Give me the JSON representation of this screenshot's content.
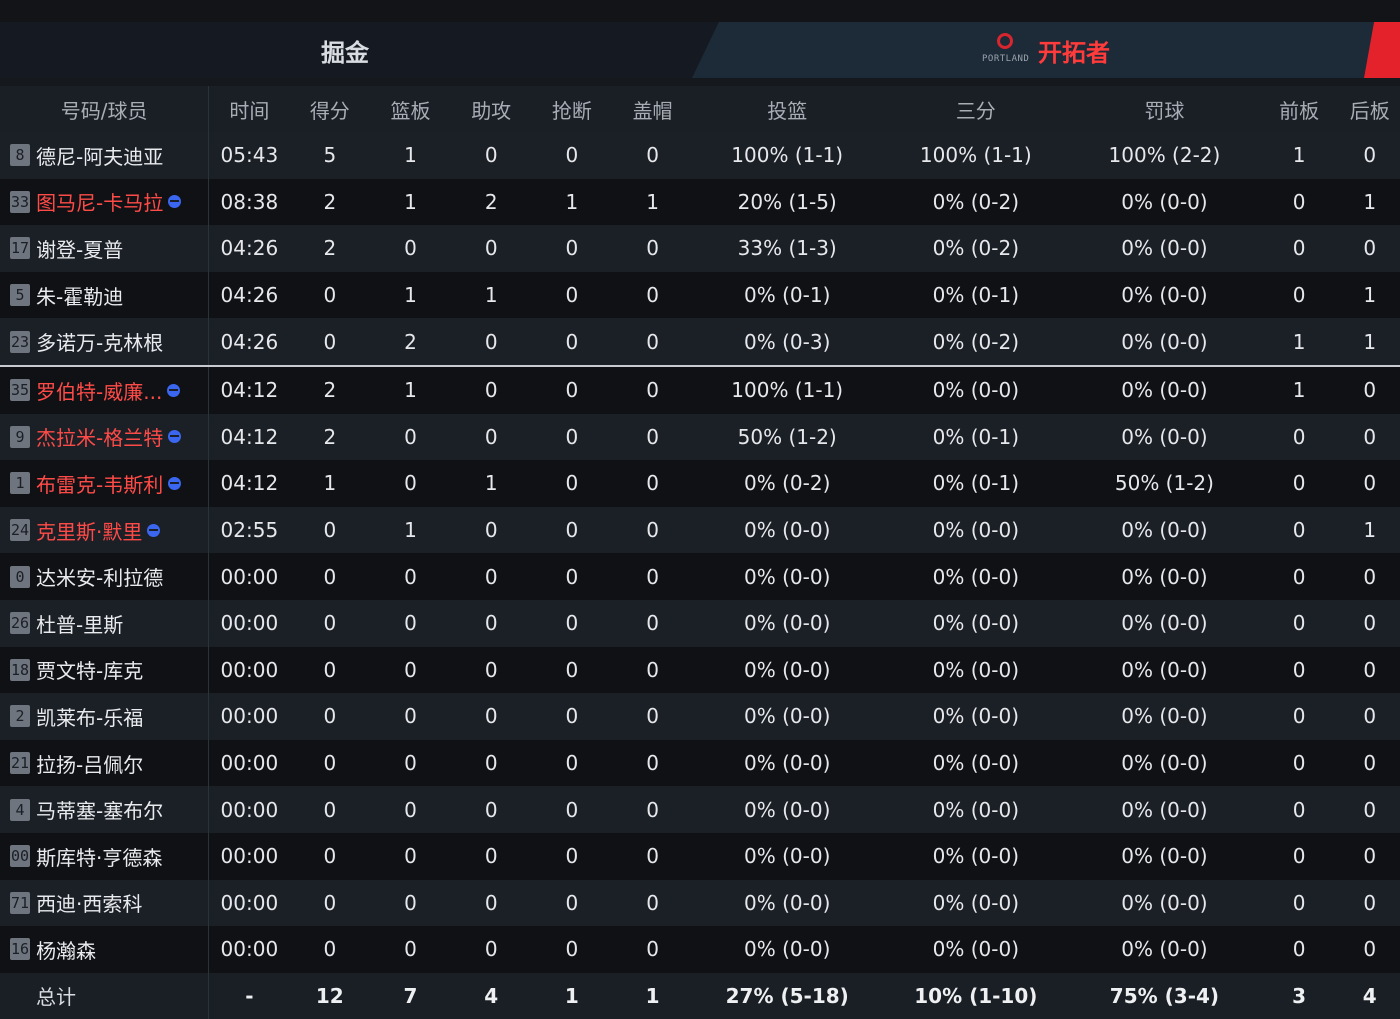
{
  "tabs": {
    "left_team": "掘金",
    "right_team": "开拓者",
    "right_logo_text": "PORTLAND"
  },
  "colors": {
    "background": "#15181d",
    "highlight_player": "#ff4b48",
    "team_accent": "#e4222b",
    "on_court_icon": "#3a66f0"
  },
  "headers": [
    "号码/球员",
    "时间",
    "得分",
    "篮板",
    "助攻",
    "抢断",
    "盖帽",
    "投篮",
    "三分",
    "罚球",
    "前板",
    "后板"
  ],
  "players": [
    {
      "num": "8",
      "name": "德尼-阿夫迪亚",
      "highlight": false,
      "oncourt": false,
      "stats": [
        "05:43",
        "5",
        "1",
        "0",
        "0",
        "0",
        "100% (1-1)",
        "100% (1-1)",
        "100% (2-2)",
        "1",
        "0"
      ]
    },
    {
      "num": "33",
      "name": "图马尼-卡马拉",
      "highlight": true,
      "oncourt": true,
      "stats": [
        "08:38",
        "2",
        "1",
        "2",
        "1",
        "1",
        "20% (1-5)",
        "0% (0-2)",
        "0% (0-0)",
        "0",
        "1"
      ]
    },
    {
      "num": "17",
      "name": "谢登-夏普",
      "highlight": false,
      "oncourt": false,
      "stats": [
        "04:26",
        "2",
        "0",
        "0",
        "0",
        "0",
        "33% (1-3)",
        "0% (0-2)",
        "0% (0-0)",
        "0",
        "0"
      ]
    },
    {
      "num": "5",
      "name": "朱-霍勒迪",
      "highlight": false,
      "oncourt": false,
      "stats": [
        "04:26",
        "0",
        "1",
        "1",
        "0",
        "0",
        "0% (0-1)",
        "0% (0-1)",
        "0% (0-0)",
        "0",
        "1"
      ]
    },
    {
      "num": "23",
      "name": "多诺万-克林根",
      "highlight": false,
      "oncourt": false,
      "stats": [
        "04:26",
        "0",
        "2",
        "0",
        "0",
        "0",
        "0% (0-3)",
        "0% (0-2)",
        "0% (0-0)",
        "1",
        "1"
      ]
    },
    {
      "num": "35",
      "name": "罗伯特-威廉...",
      "highlight": true,
      "oncourt": true,
      "stats": [
        "04:12",
        "2",
        "1",
        "0",
        "0",
        "0",
        "100% (1-1)",
        "0% (0-0)",
        "0% (0-0)",
        "1",
        "0"
      ]
    },
    {
      "num": "9",
      "name": "杰拉米-格兰特",
      "highlight": true,
      "oncourt": true,
      "stats": [
        "04:12",
        "2",
        "0",
        "0",
        "0",
        "0",
        "50% (1-2)",
        "0% (0-1)",
        "0% (0-0)",
        "0",
        "0"
      ]
    },
    {
      "num": "1",
      "name": "布雷克-韦斯利",
      "highlight": true,
      "oncourt": true,
      "stats": [
        "04:12",
        "1",
        "0",
        "1",
        "0",
        "0",
        "0% (0-2)",
        "0% (0-1)",
        "50% (1-2)",
        "0",
        "0"
      ]
    },
    {
      "num": "24",
      "name": "克里斯·默里",
      "highlight": true,
      "oncourt": true,
      "stats": [
        "02:55",
        "0",
        "1",
        "0",
        "0",
        "0",
        "0% (0-0)",
        "0% (0-0)",
        "0% (0-0)",
        "0",
        "1"
      ]
    },
    {
      "num": "0",
      "name": "达米安-利拉德",
      "highlight": false,
      "oncourt": false,
      "stats": [
        "00:00",
        "0",
        "0",
        "0",
        "0",
        "0",
        "0% (0-0)",
        "0% (0-0)",
        "0% (0-0)",
        "0",
        "0"
      ]
    },
    {
      "num": "26",
      "name": "杜普-里斯",
      "highlight": false,
      "oncourt": false,
      "stats": [
        "00:00",
        "0",
        "0",
        "0",
        "0",
        "0",
        "0% (0-0)",
        "0% (0-0)",
        "0% (0-0)",
        "0",
        "0"
      ]
    },
    {
      "num": "18",
      "name": "贾文特-库克",
      "highlight": false,
      "oncourt": false,
      "stats": [
        "00:00",
        "0",
        "0",
        "0",
        "0",
        "0",
        "0% (0-0)",
        "0% (0-0)",
        "0% (0-0)",
        "0",
        "0"
      ]
    },
    {
      "num": "2",
      "name": "凯莱布-乐福",
      "highlight": false,
      "oncourt": false,
      "stats": [
        "00:00",
        "0",
        "0",
        "0",
        "0",
        "0",
        "0% (0-0)",
        "0% (0-0)",
        "0% (0-0)",
        "0",
        "0"
      ]
    },
    {
      "num": "21",
      "name": "拉扬-吕佩尔",
      "highlight": false,
      "oncourt": false,
      "stats": [
        "00:00",
        "0",
        "0",
        "0",
        "0",
        "0",
        "0% (0-0)",
        "0% (0-0)",
        "0% (0-0)",
        "0",
        "0"
      ]
    },
    {
      "num": "4",
      "name": "马蒂塞-塞布尔",
      "highlight": false,
      "oncourt": false,
      "stats": [
        "00:00",
        "0",
        "0",
        "0",
        "0",
        "0",
        "0% (0-0)",
        "0% (0-0)",
        "0% (0-0)",
        "0",
        "0"
      ]
    },
    {
      "num": "00",
      "name": "斯库特·亨德森",
      "highlight": false,
      "oncourt": false,
      "stats": [
        "00:00",
        "0",
        "0",
        "0",
        "0",
        "0",
        "0% (0-0)",
        "0% (0-0)",
        "0% (0-0)",
        "0",
        "0"
      ]
    },
    {
      "num": "71",
      "name": "西迪·西索科",
      "highlight": false,
      "oncourt": false,
      "stats": [
        "00:00",
        "0",
        "0",
        "0",
        "0",
        "0",
        "0% (0-0)",
        "0% (0-0)",
        "0% (0-0)",
        "0",
        "0"
      ]
    },
    {
      "num": "16",
      "name": "杨瀚森",
      "highlight": false,
      "oncourt": false,
      "stats": [
        "00:00",
        "0",
        "0",
        "0",
        "0",
        "0",
        "0% (0-0)",
        "0% (0-0)",
        "0% (0-0)",
        "0",
        "0"
      ]
    }
  ],
  "totals": {
    "label": "总计",
    "stats": [
      "-",
      "12",
      "7",
      "4",
      "1",
      "1",
      "27% (5-18)",
      "10% (1-10)",
      "75% (3-4)",
      "3",
      "4"
    ]
  }
}
